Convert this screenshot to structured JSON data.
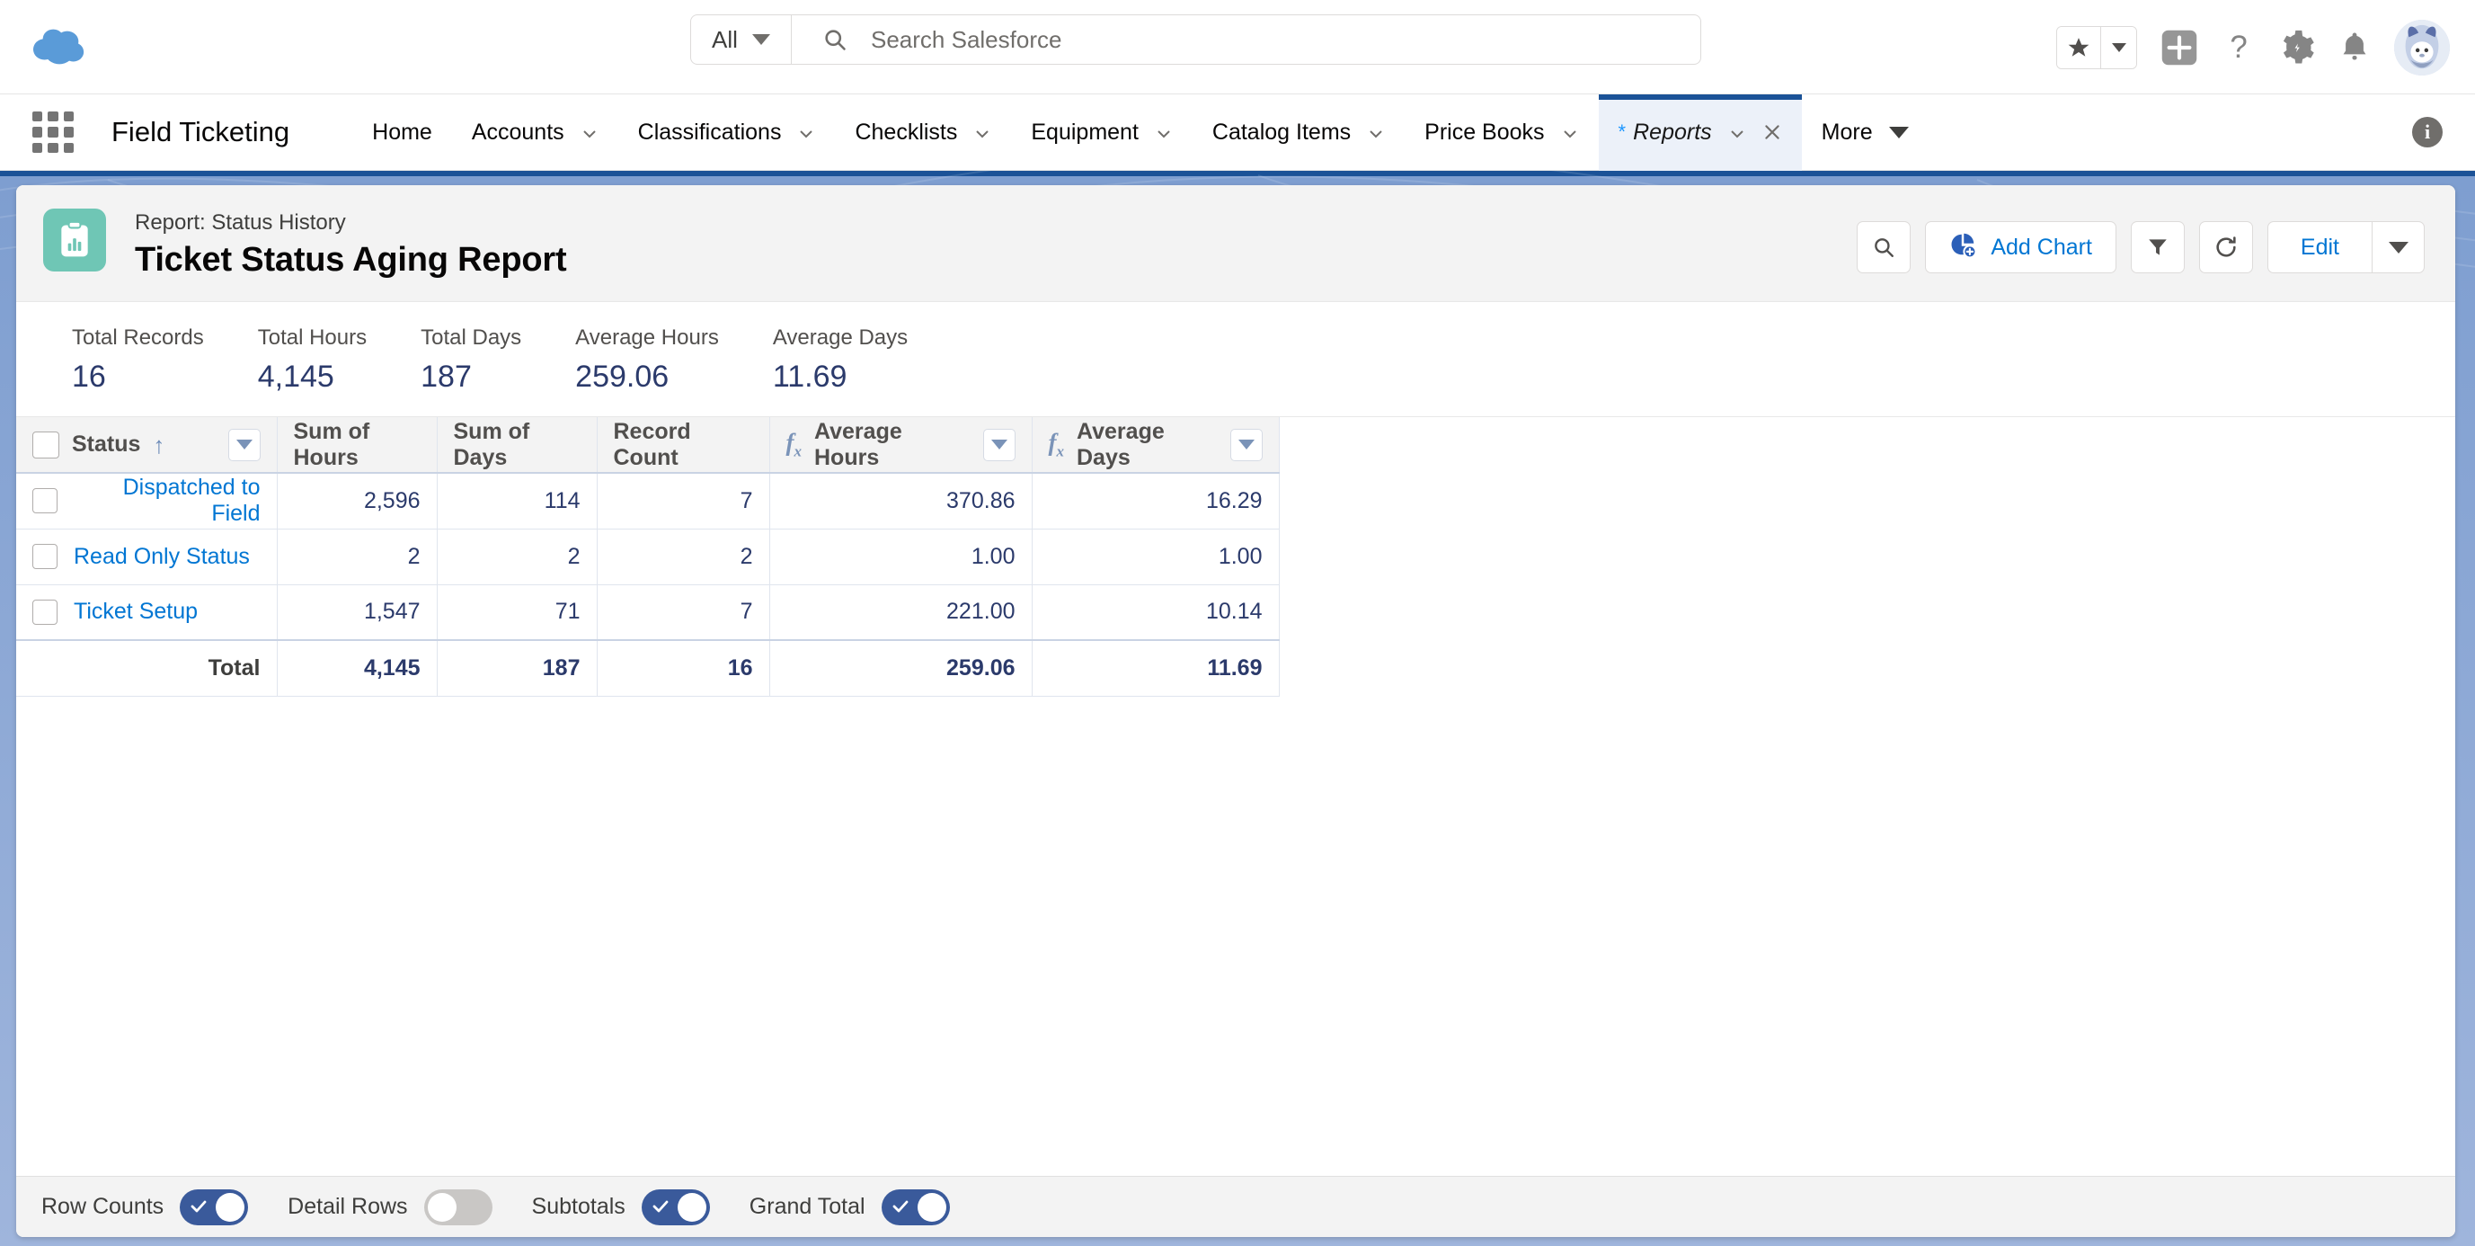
{
  "global_header": {
    "logo_name": "salesforce-cloud-logo",
    "search": {
      "scope": "All",
      "placeholder": "Search Salesforce",
      "value": ""
    },
    "icons": [
      "favorites-star-icon",
      "favorites-dropdown-icon",
      "add-icon",
      "help-icon",
      "setup-gear-icon",
      "notifications-bell-icon",
      "user-avatar"
    ]
  },
  "app_nav": {
    "app_name": "Field Ticketing",
    "items": [
      {
        "label": "Home",
        "has_dropdown": false,
        "active": false
      },
      {
        "label": "Accounts",
        "has_dropdown": true,
        "active": false
      },
      {
        "label": "Classifications",
        "has_dropdown": true,
        "active": false
      },
      {
        "label": "Checklists",
        "has_dropdown": true,
        "active": false
      },
      {
        "label": "Equipment",
        "has_dropdown": true,
        "active": false
      },
      {
        "label": "Catalog Items",
        "has_dropdown": true,
        "active": false
      },
      {
        "label": "Price Books",
        "has_dropdown": true,
        "active": false
      },
      {
        "label": "Reports",
        "has_dropdown": true,
        "active": true,
        "unsaved": true,
        "closable": true
      },
      {
        "label": "More",
        "has_dropdown": true,
        "active": false
      }
    ],
    "unsaved_marker": "*"
  },
  "report": {
    "kicker": "Report: Status History",
    "title": "Ticket Status Aging Report",
    "icon_name": "report-clipboard-chart-icon",
    "actions": {
      "search": "search-icon",
      "add_chart": "Add Chart",
      "filter": "filter-icon",
      "refresh": "refresh-icon",
      "edit": "Edit",
      "edit_menu": "chevron-down-icon"
    },
    "summary": [
      {
        "label": "Total Records",
        "value": "16"
      },
      {
        "label": "Total Hours",
        "value": "4,145"
      },
      {
        "label": "Total Days",
        "value": "187"
      },
      {
        "label": "Average Hours",
        "value": "259.06"
      },
      {
        "label": "Average Days",
        "value": "11.69"
      }
    ],
    "columns": [
      {
        "label": "Status",
        "type": "text",
        "sorted": "asc",
        "menu": true,
        "formula": false
      },
      {
        "label": "Sum of Hours",
        "type": "number",
        "menu": false,
        "formula": false
      },
      {
        "label": "Sum of Days",
        "type": "number",
        "menu": false,
        "formula": false
      },
      {
        "label": "Record Count",
        "type": "number",
        "menu": false,
        "formula": false
      },
      {
        "label": "Average Hours",
        "type": "number",
        "menu": true,
        "formula": true
      },
      {
        "label": "Average Days",
        "type": "number",
        "menu": true,
        "formula": true
      }
    ],
    "rows": [
      {
        "status": "Dispatched to Field",
        "sum_hours": "2,596",
        "sum_days": "114",
        "record_count": "7",
        "avg_hours": "370.86",
        "avg_days": "16.29"
      },
      {
        "status": "Read Only Status",
        "sum_hours": "2",
        "sum_days": "2",
        "record_count": "2",
        "avg_hours": "1.00",
        "avg_days": "1.00"
      },
      {
        "status": "Ticket Setup",
        "sum_hours": "1,547",
        "sum_days": "71",
        "record_count": "7",
        "avg_hours": "221.00",
        "avg_days": "10.14"
      }
    ],
    "total_row": {
      "status": "Total",
      "sum_hours": "4,145",
      "sum_days": "187",
      "record_count": "16",
      "avg_hours": "259.06",
      "avg_days": "11.69"
    },
    "footer_toggles": [
      {
        "label": "Row Counts",
        "on": true
      },
      {
        "label": "Detail Rows",
        "on": false
      },
      {
        "label": "Subtotals",
        "on": true
      },
      {
        "label": "Grand Total",
        "on": true
      }
    ]
  },
  "colors": {
    "brand_blue": "#0176d3",
    "nav_active": "#1b5297",
    "report_icon_teal": "#6fc6b5",
    "metric_value": "#2b3a6b",
    "toggle_on": "#3a5a9b",
    "total_row_bg": "#f0f4fb"
  }
}
